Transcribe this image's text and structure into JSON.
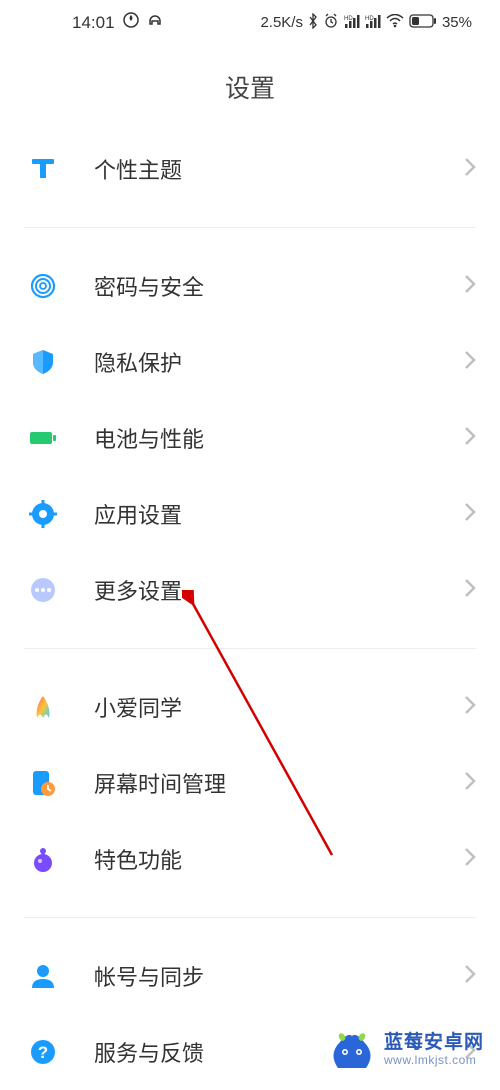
{
  "status": {
    "time": "14:01",
    "net_rate": "2.5K/s",
    "battery": "35%"
  },
  "title": "设置",
  "groups": [
    [
      {
        "icon": "theme-icon",
        "label": "个性主题"
      }
    ],
    [
      {
        "icon": "fingerprint-icon",
        "label": "密码与安全"
      },
      {
        "icon": "shield-icon",
        "label": "隐私保护"
      },
      {
        "icon": "battery-icon",
        "label": "电池与性能"
      },
      {
        "icon": "gear-icon",
        "label": "应用设置"
      },
      {
        "icon": "dots-icon",
        "label": "更多设置"
      }
    ],
    [
      {
        "icon": "xiaoai-icon",
        "label": "小爱同学"
      },
      {
        "icon": "screentime-icon",
        "label": "屏幕时间管理"
      },
      {
        "icon": "feature-icon",
        "label": "特色功能"
      }
    ],
    [
      {
        "icon": "account-icon",
        "label": "帐号与同步"
      },
      {
        "icon": "help-icon",
        "label": "服务与反馈"
      }
    ]
  ],
  "watermark": {
    "line1": "蓝莓安卓网",
    "line2": "www.lmkjst.com"
  }
}
